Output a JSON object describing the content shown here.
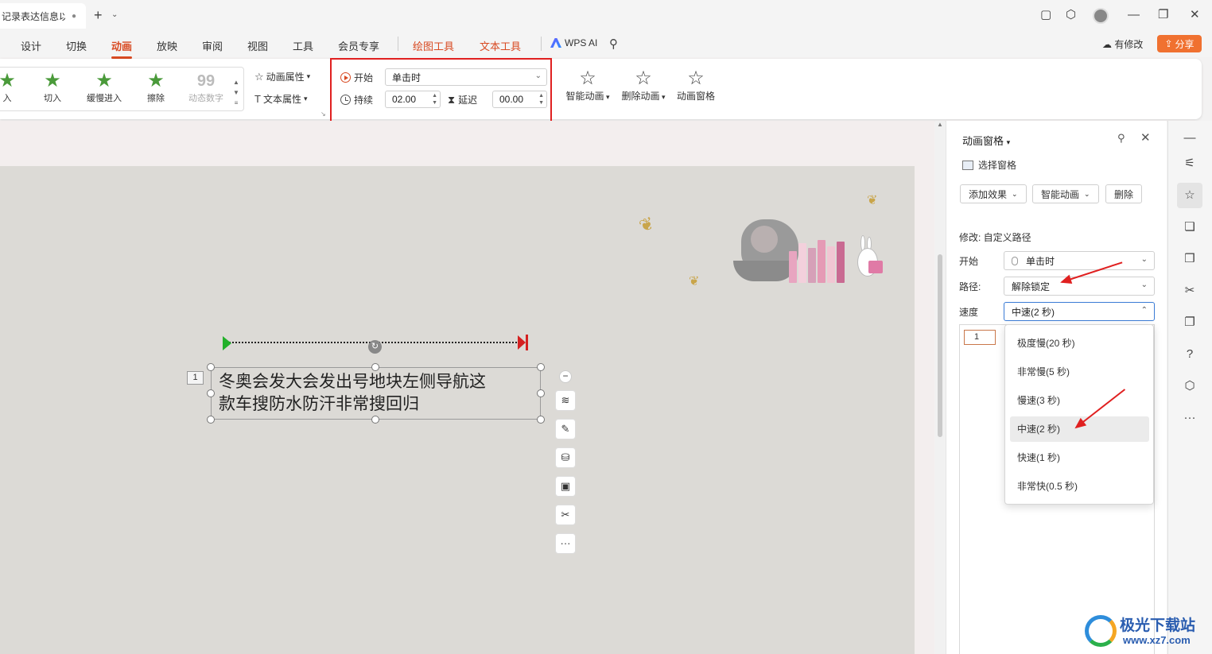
{
  "titlebar": {
    "doc_tab": "记录表达信息以…",
    "new_tab": "+",
    "new_tab_caret": "⌄",
    "window_buttons": [
      "▢",
      "⬡",
      "—",
      "❐",
      "✕"
    ]
  },
  "menu": {
    "items": [
      "设计",
      "切换",
      "动画",
      "放映",
      "审阅",
      "视图",
      "工具",
      "会员专享",
      "绘图工具",
      "文本工具"
    ],
    "active": "动画",
    "wps_ai": "WPS AI",
    "changed": "有修改",
    "share": "分享"
  },
  "ribbon": {
    "gallery": [
      {
        "label": "入",
        "icon": "star-icon"
      },
      {
        "label": "切入",
        "icon": "star-icon"
      },
      {
        "label": "缓慢进入",
        "icon": "star-icon"
      },
      {
        "label": "擦除",
        "icon": "star-icon"
      },
      {
        "label": "动态数字",
        "icon": "number-icon",
        "glyph": "99",
        "disabled": true
      }
    ],
    "anim_props": "动画属性",
    "text_props": "文本属性",
    "start_label": "开始",
    "start_value": "单击时",
    "duration_label": "持续",
    "duration_value": "02.00",
    "delay_label": "延迟",
    "delay_value": "00.00",
    "smart_anim": "智能动画",
    "delete_anim": "删除动画",
    "anim_pane": "动画窗格"
  },
  "slide": {
    "anim_number": "1",
    "text_line1": "冬奥会发大会发出号地块左侧导航这",
    "text_line2": "款车搜防水防汗非常搜回归",
    "more_tools": "···"
  },
  "pane": {
    "title": "动画窗格",
    "select_pane": "选择窗格",
    "add_effect": "添加效果",
    "smart_anim": "智能动画",
    "delete": "删除",
    "modify": "修改: 自定义路径",
    "start_label": "开始",
    "start_value": "单击时",
    "path_label": "路径:",
    "path_value": "解除锁定",
    "speed_label": "速度",
    "speed_value": "中速(2 秒)",
    "list_item": "1",
    "speed_options": [
      "极度慢(20 秒)",
      "非常慢(5 秒)",
      "慢速(3 秒)",
      "中速(2 秒)",
      "快速(1 秒)",
      "非常快(0.5 秒)"
    ],
    "selected_option": "中速(2 秒)"
  },
  "watermark": {
    "title": "极光下载站",
    "url": "www.xz7.com"
  },
  "colors": {
    "accent": "#d84a22",
    "share": "#f07130",
    "highlight_box": "#e02020",
    "path_start": "#22b02a",
    "path_end": "#d42020"
  }
}
